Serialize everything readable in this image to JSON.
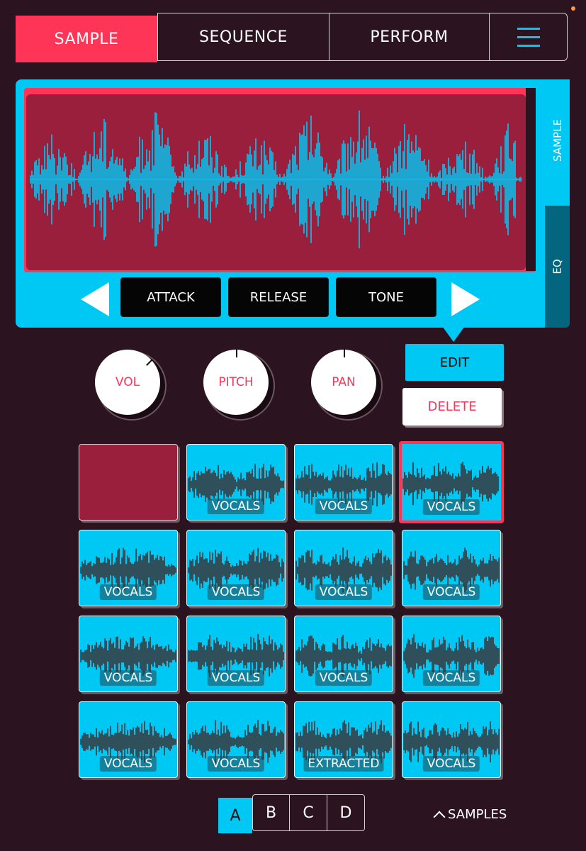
{
  "tabs": {
    "sample": "SAMPLE",
    "sequence": "SEQUENCE",
    "perform": "PERFORM"
  },
  "side_tabs": {
    "sample": "SAMPLE",
    "eq": "EQ"
  },
  "params": {
    "attack": "ATTACK",
    "release": "RELEASE",
    "tone": "TONE"
  },
  "knobs": {
    "vol": "VOL",
    "pitch": "PITCH",
    "pan": "PAN"
  },
  "actions": {
    "edit": "EDIT",
    "delete": "DELETE"
  },
  "pads": [
    {
      "label": ""
    },
    {
      "label": "VOCALS"
    },
    {
      "label": "VOCALS"
    },
    {
      "label": "VOCALS"
    },
    {
      "label": "VOCALS"
    },
    {
      "label": "VOCALS"
    },
    {
      "label": "VOCALS"
    },
    {
      "label": "VOCALS"
    },
    {
      "label": "VOCALS"
    },
    {
      "label": "VOCALS"
    },
    {
      "label": "VOCALS"
    },
    {
      "label": "VOCALS"
    },
    {
      "label": "VOCALS"
    },
    {
      "label": "VOCALS"
    },
    {
      "label": "EXTRACTED"
    },
    {
      "label": "VOCALS"
    }
  ],
  "banks": {
    "a": "A",
    "b": "B",
    "c": "C",
    "d": "D"
  },
  "samples_link": "SAMPLES",
  "colors": {
    "accent": "#ff3558",
    "cyan": "#00c8f5",
    "background": "#2b1320",
    "wave_bg": "#9a1f3d"
  }
}
